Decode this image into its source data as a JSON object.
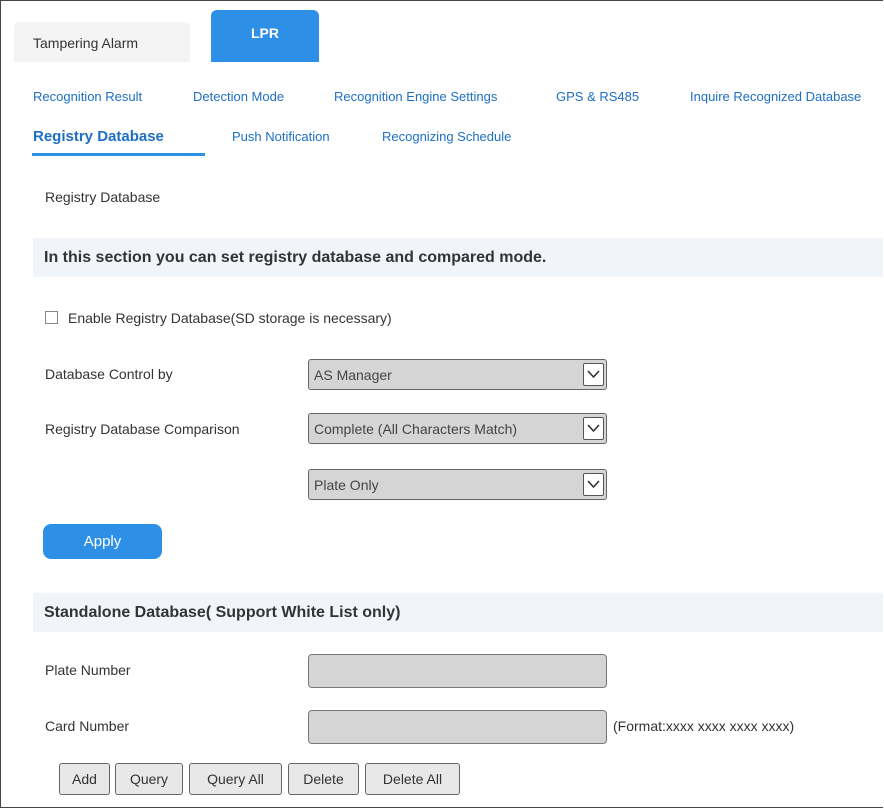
{
  "top_tabs": {
    "tampering": "Tampering Alarm",
    "lpr": "LPR"
  },
  "subnav": {
    "recognition_result": "Recognition Result",
    "detection_mode": "Detection Mode",
    "engine_settings": "Recognition Engine Settings",
    "gps_rs485": "GPS & RS485",
    "inquire_db": "Inquire Recognized Database",
    "registry_db": "Registry Database",
    "push_notification": "Push Notification",
    "schedule": "Recognizing Schedule"
  },
  "page_title": "Registry Database",
  "section1": {
    "heading": "In this section you can set registry database and compared mode.",
    "enable_label": "Enable Registry Database(SD storage is necessary)",
    "enable_checked": false,
    "control_label": "Database Control by",
    "control_value": "AS Manager",
    "comparison_label": "Registry Database Comparison",
    "comparison_value": "Complete (All Characters Match)",
    "scope_value": "Plate Only",
    "apply_label": "Apply"
  },
  "section2": {
    "heading": "Standalone Database( Support White List only)",
    "plate_label": "Plate Number",
    "plate_value": "",
    "card_label": "Card Number",
    "card_value": "",
    "card_hint": "(Format:xxxx xxxx xxxx xxxx)",
    "buttons": {
      "add": "Add",
      "query": "Query",
      "query_all": "Query All",
      "delete": "Delete",
      "delete_all": "Delete All"
    }
  },
  "colors": {
    "accent": "#2d8fe6",
    "link": "#1e6fc4",
    "section_bg": "#f1f5fa",
    "field_bg": "#d5d5d5"
  }
}
